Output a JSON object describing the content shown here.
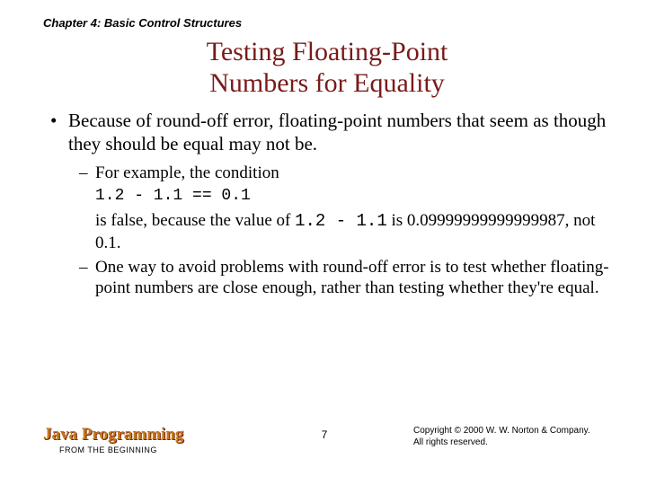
{
  "chapter": "Chapter 4: Basic Control Structures",
  "title_line1": "Testing Floating-Point",
  "title_line2": "Numbers for Equality",
  "bullet1": "Because of round-off error, floating-point numbers that seem as though they should be equal may not be.",
  "sub1": "For example, the condition",
  "code_line": "1.2 - 1.1 == 0.1",
  "sub1_cont_a": "is false, because the value of ",
  "sub1_cont_code": "1.2 - 1.1",
  "sub1_cont_b": " is 0.09999999999999987, not 0.1.",
  "sub2": "One way to avoid problems with round-off error is to test whether floating-point numbers are close enough, rather than testing whether they're equal.",
  "footer": {
    "brand": "Java Programming",
    "subtitle": "FROM THE BEGINNING",
    "page": "7",
    "copyright1": "Copyright © 2000 W. W. Norton & Company.",
    "copyright2": "All rights reserved."
  }
}
